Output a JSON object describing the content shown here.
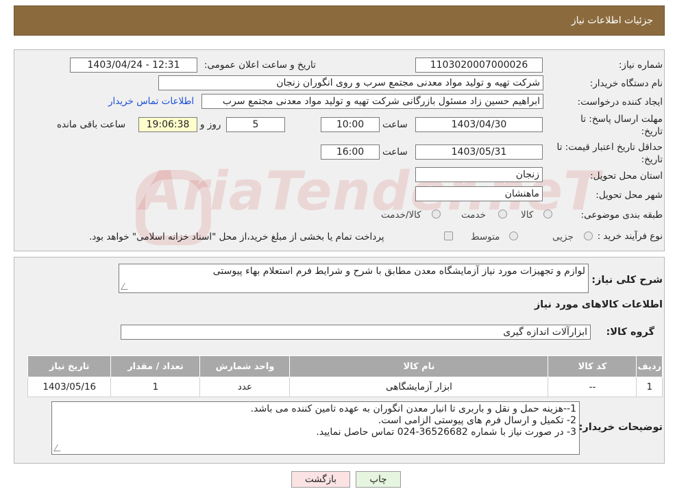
{
  "header": {
    "title": "جزئیات اطلاعات نیاز"
  },
  "form": {
    "need_number_label": "شماره نیاز:",
    "need_number": "1103020007000026",
    "announce_label": "تاریخ و ساعت اعلان عمومی:",
    "announce_value": "1403/04/24 - 12:31",
    "buyer_label": "نام دستگاه خریدار:",
    "buyer_value": "شرکت تهیه و تولید مواد معدنی مجتمع سرب و روی انگوران   زنجان",
    "creator_label": "ایجاد کننده درخواست:",
    "creator_value": "ابراهیم حسین زاد مسئول بازرگانی شرکت تهیه و تولید مواد معدنی مجتمع سرب",
    "contact_link": "اطلاعات تماس خریدار",
    "deadline_label_1": "مهلت ارسال پاسخ: تا",
    "deadline_label_2": "تاریخ:",
    "deadline_date": "1403/04/30",
    "time_label": "ساعت",
    "deadline_time": "10:00",
    "days_value": "5",
    "days_label": "روز و",
    "remaining_time": "19:06:38",
    "remaining_label": "ساعت باقی مانده",
    "validity_label_1": "حداقل تاریخ اعتبار قیمت: تا",
    "validity_label_2": "تاریخ:",
    "validity_date": "1403/05/31",
    "validity_time": "16:00",
    "province_label": "استان محل تحویل:",
    "province_value": "زنجان",
    "city_label": "شهر محل تحویل:",
    "city_value": "ماهنشان",
    "category_label": "طبقه بندی موضوعی:",
    "category_options": [
      "کالا",
      "خدمت",
      "کالا/خدمت"
    ],
    "process_label": "نوع فرآیند خرید :",
    "process_options": [
      "جزیی",
      "متوسط"
    ],
    "process_note": "پرداخت تمام یا بخشی از مبلغ خرید،از محل \"اسناد خزانه اسلامی\" خواهد بود."
  },
  "details": {
    "summary_label": "شرح کلی نیاز:",
    "summary_value": "لوازم و تجهیزات مورد نیاز آزمایشگاه معدن مطابق با شرح و شرایط فرم استعلام بهاء پیوستی",
    "goods_info_title": "اطلاعات کالاهای مورد نیاز",
    "goods_group_label": "گروه کالا:",
    "goods_group_value": "ابزارآلات اندازه گیری",
    "table": {
      "headers": [
        "ردیف",
        "کد کالا",
        "نام کالا",
        "واحد شمارش",
        "تعداد / مقدار",
        "تاریخ نیاز"
      ],
      "rows": [
        [
          "1",
          "--",
          "ابزار آزمایشگاهی",
          "عدد",
          "1",
          "1403/05/16"
        ]
      ]
    },
    "buyer_notes_label": "توضیحات خریدار:",
    "buyer_notes_lines": [
      "1--هزینه حمل و نقل و باربری تا انبار معدن انگوران به عهده تامین کننده می باشد.",
      "2- تکمیل و ارسال فرم های پیوستی الزامی است.",
      "3- در صورت نیاز با شماره 36526682-024 تماس حاصل نمایید."
    ]
  },
  "buttons": {
    "print": "چاپ",
    "back": "بازگشت"
  },
  "watermark": "AriaTender.neT",
  "colors": {
    "header_bg": "#8b6b3e",
    "link": "#1a4fd6",
    "back_button_bg": "#fbe3e3",
    "print_button_bg": "#e6f5e0"
  }
}
